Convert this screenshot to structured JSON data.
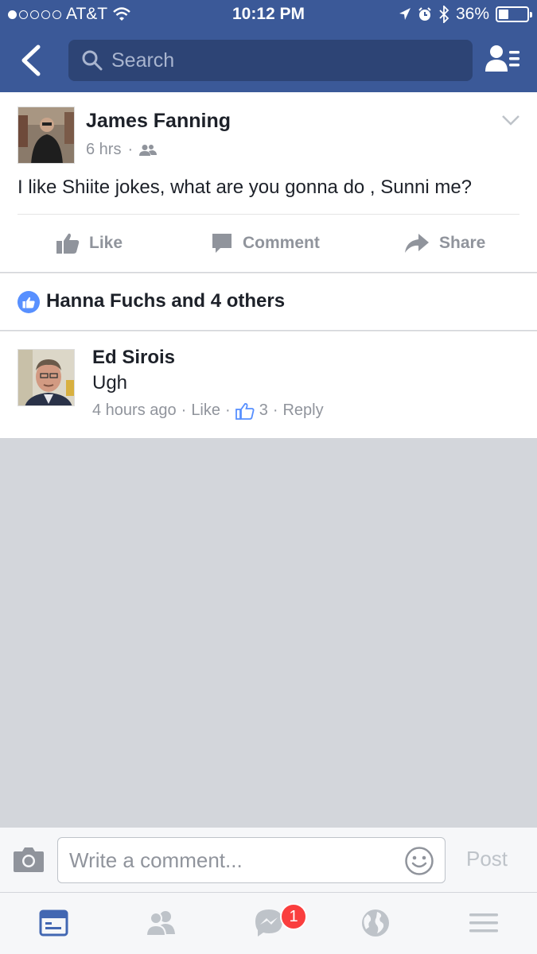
{
  "status_bar": {
    "carrier": "AT&T",
    "time": "10:12 PM",
    "battery": "36%",
    "battery_level": 0.36
  },
  "header": {
    "search_placeholder": "Search"
  },
  "post": {
    "author": "James Fanning",
    "time": "6 hrs",
    "privacy_icon": "friends-icon",
    "text": "I like Shiite jokes, what are you gonna do , Sunni me?",
    "actions": {
      "like": "Like",
      "comment": "Comment",
      "share": "Share"
    }
  },
  "likes": {
    "summary": "Hanna Fuchs and 4 others"
  },
  "comment": {
    "author": "Ed Sirois",
    "text": "Ugh",
    "time": "4 hours ago",
    "like_label": "Like",
    "like_count": "3",
    "reply_label": "Reply"
  },
  "composer": {
    "placeholder": "Write a comment...",
    "post_label": "Post"
  },
  "tabbar": {
    "messenger_badge": "1",
    "tabs": [
      "news-feed-icon",
      "friend-requests-icon",
      "messenger-icon",
      "notifications-globe-icon",
      "menu-icon"
    ]
  },
  "colors": {
    "brand": "#3b5998",
    "like_blue": "#5890ff",
    "badge_red": "#fa3e3e"
  }
}
